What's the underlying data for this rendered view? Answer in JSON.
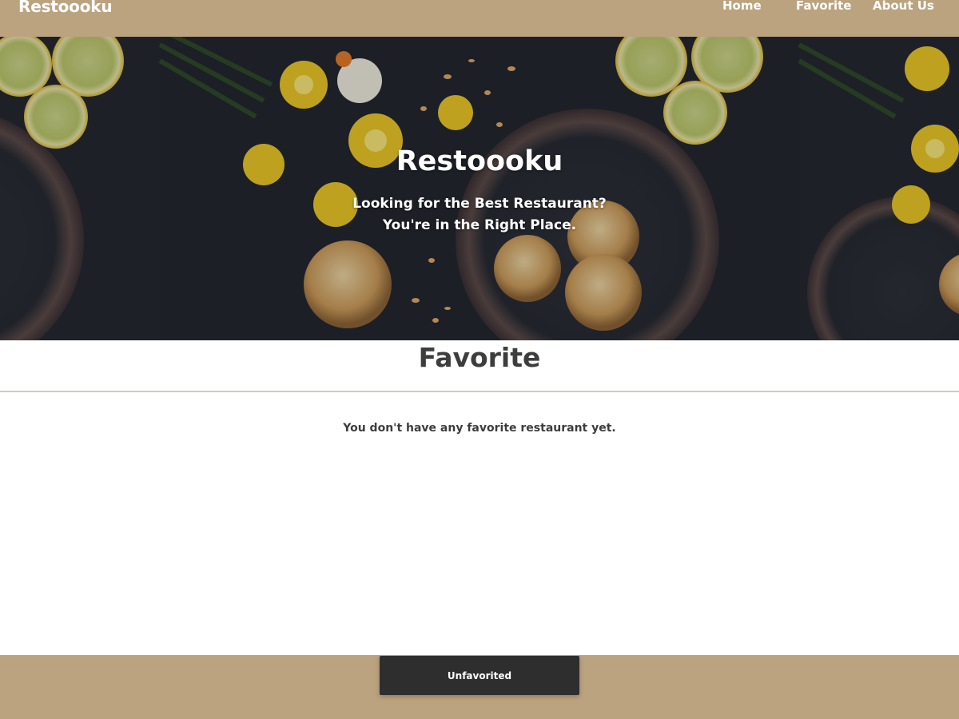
{
  "navbar": {
    "brand": "Restoooku",
    "links": [
      {
        "label": "Home"
      },
      {
        "label": "Favorite"
      },
      {
        "label": "About Us"
      }
    ]
  },
  "hero": {
    "title": "Restoooku",
    "subtitle_line1": "Looking for the Best Restaurant?",
    "subtitle_line2": "You're in the Right Place."
  },
  "main": {
    "section_title": "Favorite",
    "empty_message": "You don't have any favorite restaurant yet."
  },
  "footer": {
    "text": ""
  },
  "toast": {
    "message": "Unfavorited"
  },
  "colors": {
    "brand_bar": "#bba37f",
    "heading_text": "#3d3d3d",
    "toast_bg": "#2e2e2e"
  }
}
